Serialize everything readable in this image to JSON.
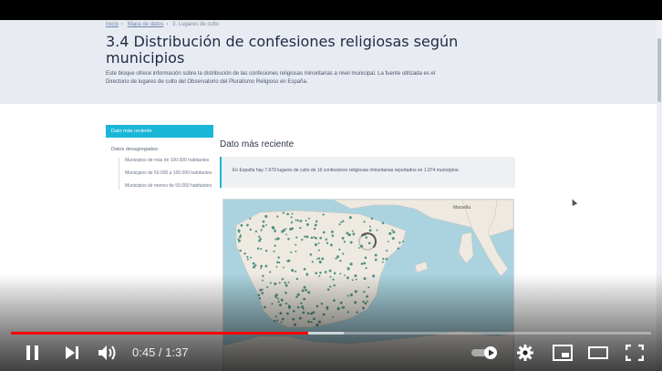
{
  "page": {
    "breadcrumb": [
      "Inicio",
      "Mapa de datos",
      "3. Lugares de culto"
    ],
    "title": "3.4 Distribución de confesiones religiosas según municipios",
    "intro": "Este bloque ofrece información sobre la distribución de las confesiones religiosas minoritarias a nivel municipal. La fuente utilizada es el Directorio de lugares de culto del Observatorio del Pluralismo Religioso en España."
  },
  "side_nav": {
    "active": "Dato más reciente",
    "group": "Datos desagregados:",
    "items": [
      "Municipios de más de 100.000 habitantes",
      "Municipios de 50.000 a 100.000 habitantes",
      "Municipios de menos de 50.000 habitantes"
    ]
  },
  "main": {
    "section_title": "Dato más reciente",
    "info_text": "En España hay 7.679 lugares de culto de 16 confesiones religiosas minoritarias reportados en 1.974 municipios."
  },
  "map": {
    "labels": [
      "Marsella"
    ],
    "colors": {
      "sea": "#aad3df",
      "land": "#eeeae2",
      "dot": "#2e7d6a"
    }
  },
  "player": {
    "time_current": "0:45",
    "time_total": "1:37",
    "time_display": "0:45 / 1:37",
    "progress_played": 0.464,
    "progress_buffered": 0.52,
    "accent": "#ff0000"
  }
}
